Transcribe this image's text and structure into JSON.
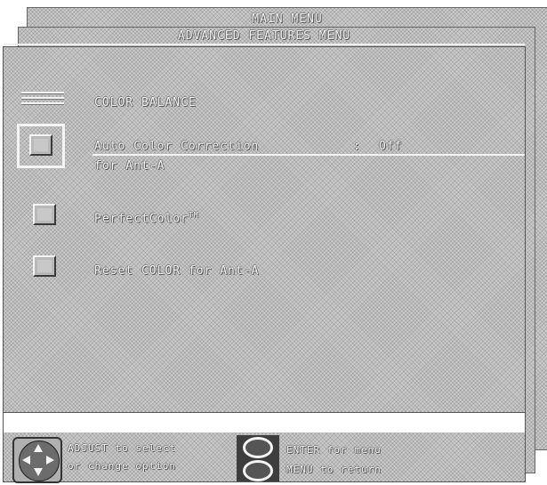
{
  "main_menu_title": "MAIN MENU",
  "submenu_title": "ADVANCED FEATURES MENU",
  "section_heading": "COLOR BALANCE",
  "items": [
    {
      "label": "Auto Color Correction",
      "separator": ":",
      "value": "Off",
      "line2": "for Ant-A"
    },
    {
      "label": "PerfectColor",
      "superscript": "TM"
    },
    {
      "label": "Reset COLOR for Ant-A"
    }
  ],
  "hints": {
    "adjust_line1": "ADJUST to select",
    "adjust_line2": "or change option",
    "enter_line": "ENTER for menu",
    "menu_line": "MENU to return"
  },
  "colors": {
    "panel": "#cbcbcb",
    "text": "#f4f4f4",
    "shadow": "#555555"
  },
  "icons": [
    "menu-bars-icon",
    "dpad-icon",
    "enter-oval-icon",
    "menu-oval-icon"
  ]
}
